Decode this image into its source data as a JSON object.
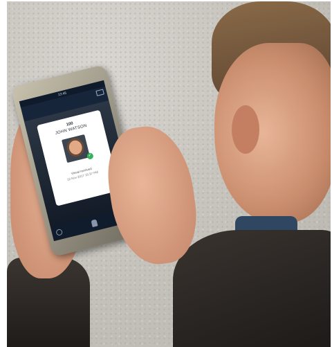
{
  "phone": {
    "status_time": "13:45",
    "card": {
      "id": "100",
      "name": "JOHN WATSON",
      "status": "Visual received",
      "timestamp": "12 Nov 2017 15:37 PM",
      "verified": true
    },
    "icons": [
      "camera-icon",
      "info-icon",
      "person-icon",
      "settings-icon",
      "check-icon"
    ]
  },
  "colors": {
    "screen_bg": "#17253a",
    "card_bg": "#ffffff",
    "check_green": "#33b25a"
  }
}
